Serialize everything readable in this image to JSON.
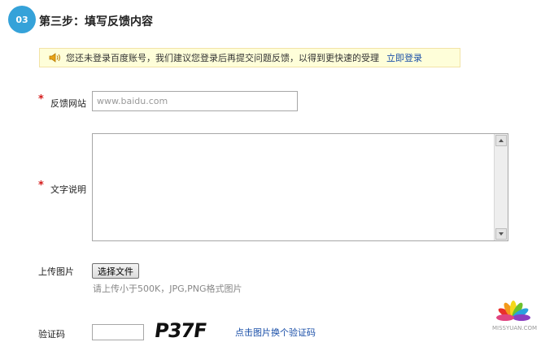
{
  "step": {
    "number": "03",
    "title": "第三步：填写反馈内容"
  },
  "notice": {
    "icon": "speaker-icon",
    "text": "您还未登录百度账号，我们建议您登录后再提交问题反馈，以得到更快速的受理",
    "link": "立即登录"
  },
  "form": {
    "required_mark": "*",
    "website_label": "反馈网站",
    "website_value": "www.baidu.com",
    "description_label": "文字说明",
    "upload_label": "上传图片",
    "upload_button": "选择文件",
    "upload_hint": "请上传小于500K，JPG,PNG格式图片",
    "captcha_label": "验证码",
    "captcha_text": "P37F",
    "captcha_refresh": "点击图片换个验证码"
  },
  "watermark": {
    "text": "MISSYUAN.COM"
  },
  "colors": {
    "accent_blue": "#35a2d9",
    "link": "#1a4fa8",
    "required": "#d41a1a",
    "notice_bg": "#fefed9",
    "notice_border": "#f2e3a6"
  }
}
